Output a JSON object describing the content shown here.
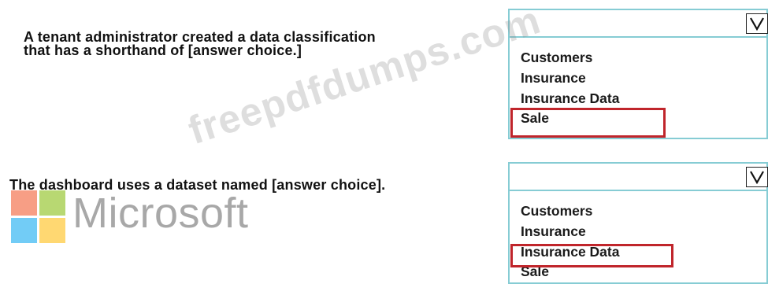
{
  "question1": {
    "text_line1": "A tenant administrator created a data classification",
    "text_line2": "that has a shorthand of [answer choice.]",
    "dropdown": {
      "selected": "",
      "options": [
        "Customers",
        "Insurance",
        "Insurance Data",
        "Sale"
      ],
      "highlighted_option": "Sale"
    }
  },
  "question2": {
    "text": "The dashboard uses a dataset named [answer choice].",
    "dropdown": {
      "selected": "",
      "options": [
        "Customers",
        "Insurance",
        "Insurance Data",
        "Sale"
      ],
      "highlighted_option": "Insurance Data"
    }
  },
  "logo": {
    "word": "Microsoft"
  },
  "watermark": "freepdfdumps.com",
  "colors": {
    "dropdown_border": "#86ccd4",
    "highlight_border": "#c0252b"
  },
  "icons": [
    "chevron-down-icon",
    "microsoft-logo-icon"
  ]
}
